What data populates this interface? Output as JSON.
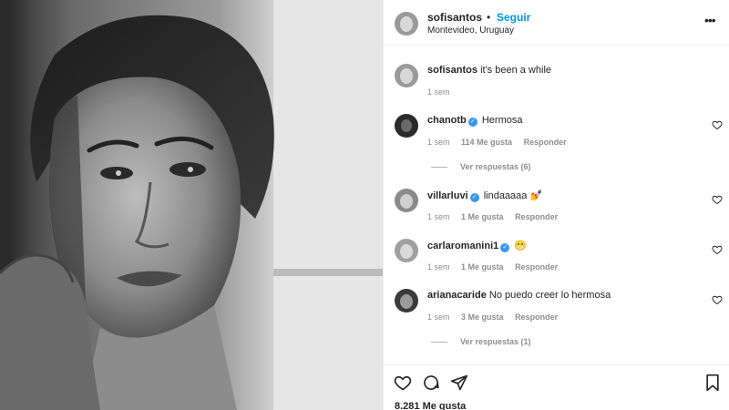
{
  "post": {
    "author": "sofisantos",
    "dot": "•",
    "follow_label": "Seguir",
    "location": "Montevideo, Uruguay",
    "more_icon": "more-options-icon"
  },
  "caption": {
    "username": "sofisantos",
    "text": "it's been a while",
    "time": "1 sem"
  },
  "comments": [
    {
      "username": "chanotb",
      "verified": true,
      "text": "Hermosa",
      "time": "1 sem",
      "likes": "114 Me gusta",
      "reply": "Responder",
      "view_replies": "Ver respuestas (6)"
    },
    {
      "username": "villarluvi",
      "verified": true,
      "text": "lindaaaaa 💅",
      "time": "1 sem",
      "likes": "1 Me gusta",
      "reply": "Responder"
    },
    {
      "username": "carlaromanini1",
      "verified": true,
      "text": "😁",
      "time": "1 sem",
      "likes": "1 Me gusta",
      "reply": "Responder"
    },
    {
      "username": "arianacaride",
      "verified": false,
      "text": "No puedo creer lo hermosa",
      "time": "1 sem",
      "likes": "3 Me gusta",
      "reply": "Responder",
      "view_replies": "Ver respuestas (1)"
    }
  ],
  "footer": {
    "likes_count": "8.281 Me gusta"
  },
  "colors": {
    "accent": "#0095f6",
    "verified": "#3897f0",
    "muted": "#8e8e8e",
    "text": "#262626"
  }
}
